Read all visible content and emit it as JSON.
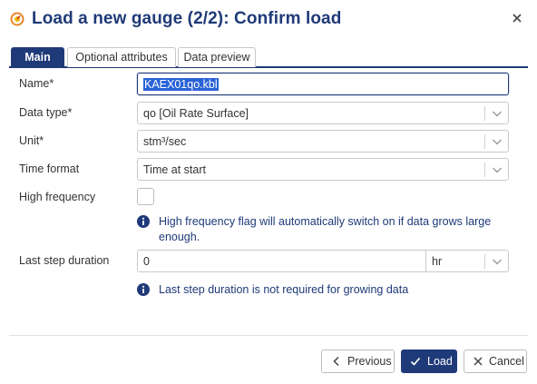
{
  "dialog": {
    "title": "Load a new gauge (2/2): Confirm load",
    "icon": "gauge-icon",
    "close_icon": "close-icon",
    "accent_color": "#1f3a78",
    "icon_color": "#e8862a"
  },
  "tabs": [
    {
      "label": "Main",
      "active": true
    },
    {
      "label": "Optional attributes",
      "active": false
    },
    {
      "label": "Data preview",
      "active": false
    }
  ],
  "form": {
    "name": {
      "label": "Name",
      "required_mark": "*",
      "value": "KAEX01qo.kbl"
    },
    "data_type": {
      "label": "Data type",
      "required_mark": "*",
      "value": "qo [Oil Rate Surface]"
    },
    "unit": {
      "label": "Unit",
      "required_mark": "*",
      "value": "stm³/sec"
    },
    "time_format": {
      "label": "Time format",
      "value": "Time at start"
    },
    "high_frequency": {
      "label": "High frequency",
      "checked": false,
      "info": "High frequency flag will automatically switch on if data grows large enough."
    },
    "last_step_duration": {
      "label": "Last step duration",
      "value": "0",
      "unit": "hr",
      "info": "Last step duration is not required for growing data"
    }
  },
  "buttons": {
    "previous": "Previous",
    "load": "Load",
    "cancel": "Cancel"
  }
}
